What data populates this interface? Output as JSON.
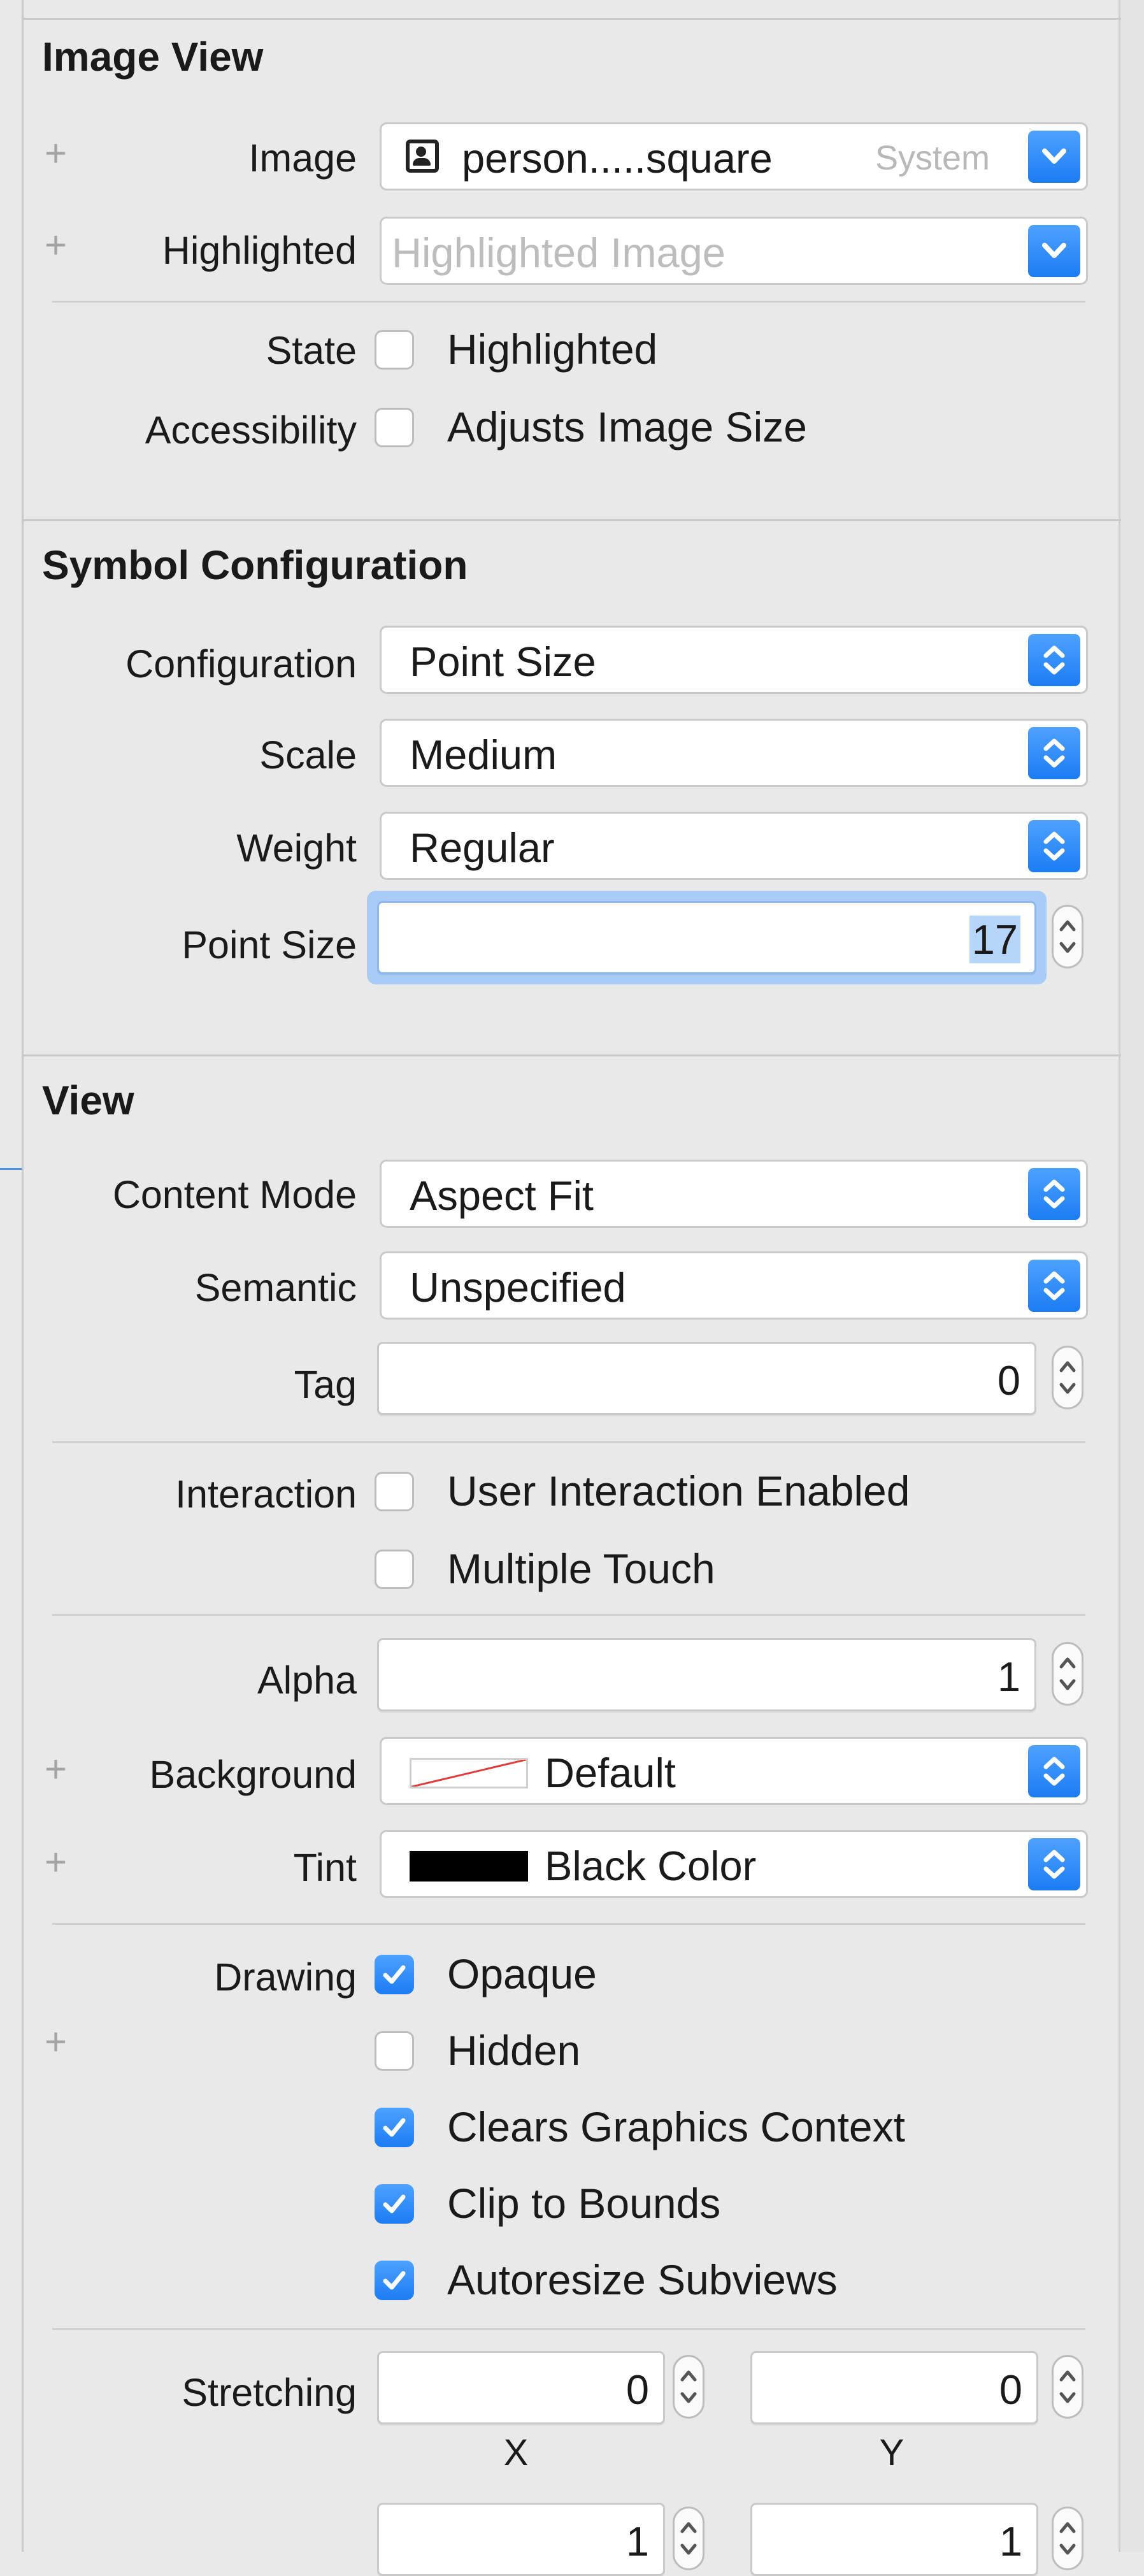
{
  "image_view": {
    "header": "Image View",
    "image_label": "Image",
    "image_value": "person.....square",
    "image_source": "System",
    "highlighted_label": "Highlighted",
    "highlighted_placeholder": "Highlighted Image",
    "state_label": "State",
    "state_option": "Highlighted",
    "state_checked": false,
    "accessibility_label": "Accessibility",
    "accessibility_option": "Adjusts Image Size",
    "accessibility_checked": false
  },
  "symbol_configuration": {
    "header": "Symbol Configuration",
    "configuration_label": "Configuration",
    "configuration_value": "Point Size",
    "scale_label": "Scale",
    "scale_value": "Medium",
    "weight_label": "Weight",
    "weight_value": "Regular",
    "point_size_label": "Point Size",
    "point_size_value": "17"
  },
  "view": {
    "header": "View",
    "content_mode_label": "Content Mode",
    "content_mode_value": "Aspect Fit",
    "semantic_label": "Semantic",
    "semantic_value": "Unspecified",
    "tag_label": "Tag",
    "tag_value": "0",
    "interaction_label": "Interaction",
    "interaction_options": [
      {
        "label": "User Interaction Enabled",
        "checked": false
      },
      {
        "label": "Multiple Touch",
        "checked": false
      }
    ],
    "alpha_label": "Alpha",
    "alpha_value": "1",
    "background_label": "Background",
    "background_value": "Default",
    "tint_label": "Tint",
    "tint_value": "Black Color",
    "tint_swatch_color": "#000000",
    "drawing_label": "Drawing",
    "drawing_options": [
      {
        "label": "Opaque",
        "checked": true
      },
      {
        "label": "Hidden",
        "checked": false
      },
      {
        "label": "Clears Graphics Context",
        "checked": true
      },
      {
        "label": "Clip to Bounds",
        "checked": true
      },
      {
        "label": "Autoresize Subviews",
        "checked": true
      }
    ],
    "stretching_label": "Stretching",
    "stretching_x": "0",
    "stretching_y": "0",
    "x_label": "X",
    "y_label": "Y",
    "width_value": "1",
    "height_value": "1"
  },
  "colors": {
    "accent": "#1c7cf4",
    "selection": "#b5d5fb",
    "panel_background": "#e9e9e9"
  }
}
